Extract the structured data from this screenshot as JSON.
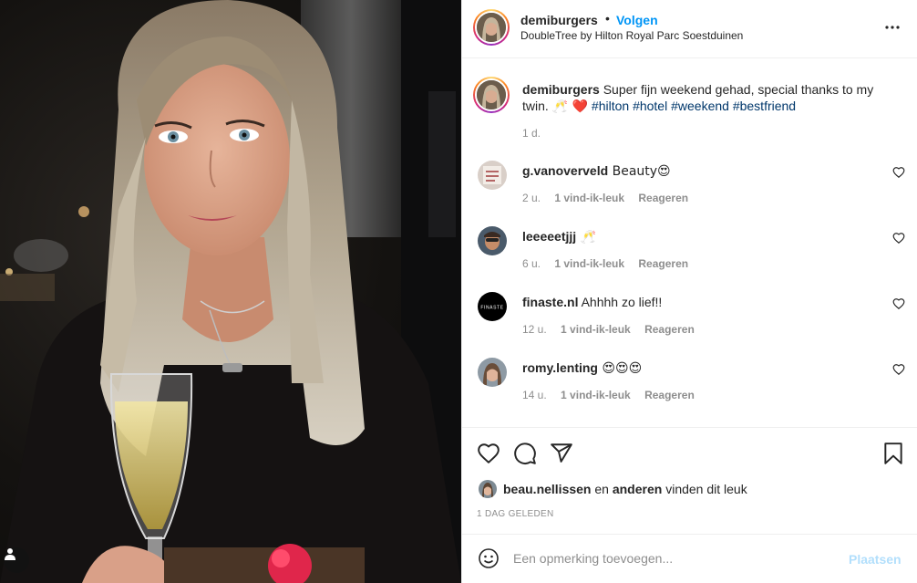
{
  "post": {
    "username": "demiburgers",
    "dot": "•",
    "follow_label": "Volgen",
    "location": "DoubleTree by Hilton Royal Parc Soestduinen",
    "more_icon": "more-horizontal-icon",
    "caption": {
      "username": "demiburgers",
      "text": " Super fijn weekend gehad, special thanks to my twin. ",
      "emojis": "🥂 ❤️",
      "hashtags": [
        "#hilton",
        "#hotel",
        "#weekend",
        "#bestfriend"
      ],
      "time": "1 d."
    }
  },
  "comments": [
    {
      "username": "g.vanoverveld",
      "text": " Beauty😍",
      "time": "2 u.",
      "likes": "1 vind-ik-leuk",
      "reply": "Reageren"
    },
    {
      "username": "leeeeetjjj",
      "text": " 🥂",
      "time": "6 u.",
      "likes": "1 vind-ik-leuk",
      "reply": "Reageren"
    },
    {
      "username": "finaste.nl",
      "text": " Ahhhh zo lief!!",
      "time": "12 u.",
      "likes": "1 vind-ik-leuk",
      "reply": "Reageren",
      "avatar_text": "FINASTE"
    },
    {
      "username": "romy.lenting",
      "text": " 😍😍😍",
      "time": "14 u.",
      "likes": "1 vind-ik-leuk",
      "reply": "Reageren"
    }
  ],
  "likes": {
    "user": "beau.nellissen",
    "middle": " en ",
    "others": "anderen",
    "suffix": " vinden dit leuk"
  },
  "date": "1 dag geleden",
  "composer": {
    "placeholder": "Een opmerking toevoegen...",
    "post_label": "Plaatsen"
  },
  "colors": {
    "link": "#0095f6",
    "hashtag": "#00376b",
    "muted": "#8e8e8e",
    "post_disabled": "#b2dffc"
  }
}
